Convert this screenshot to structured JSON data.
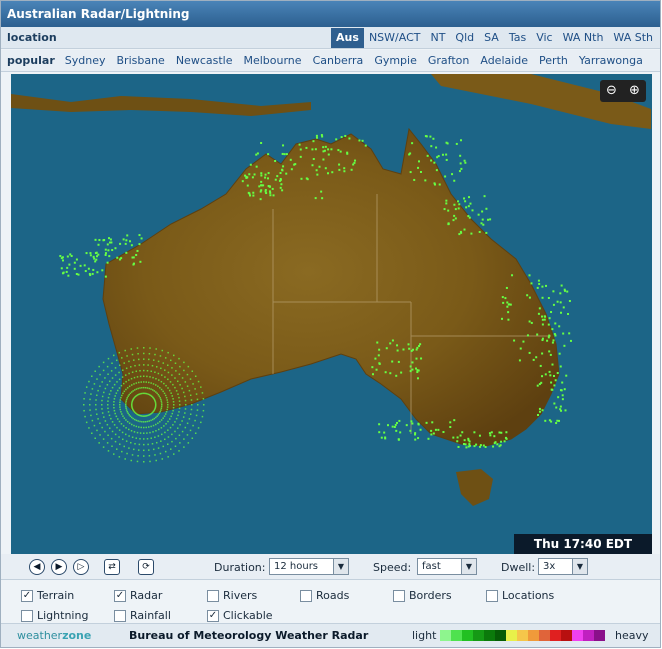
{
  "title": "Australian Radar/Lightning",
  "location": {
    "label": "location",
    "regions": [
      "Aus",
      "NSW/ACT",
      "NT",
      "Qld",
      "SA",
      "Tas",
      "Vic",
      "WA Nth",
      "WA Sth"
    ],
    "active_region": "Aus"
  },
  "popular": {
    "label": "popular",
    "cities": [
      "Sydney",
      "Brisbane",
      "Newcastle",
      "Melbourne",
      "Canberra",
      "Gympie",
      "Grafton",
      "Adelaide",
      "Perth",
      "Yarrawonga"
    ]
  },
  "map": {
    "timestamp": "Thu 17:40 EDT",
    "zoom_out_icon": "zoom-out-icon",
    "zoom_in_icon": "zoom-in-icon",
    "colors": {
      "ocean": "#1c6587",
      "land": "#7a5a1a",
      "radar_echo": "#66ff44"
    }
  },
  "controls": {
    "duration_label": "Duration:",
    "duration_value": "12 hours",
    "speed_label": "Speed:",
    "speed_value": "fast",
    "dwell_label": "Dwell:",
    "dwell_value": "3x"
  },
  "layers": [
    {
      "label": "Terrain",
      "checked": true
    },
    {
      "label": "Radar",
      "checked": true
    },
    {
      "label": "Rivers",
      "checked": false
    },
    {
      "label": "Roads",
      "checked": false
    },
    {
      "label": "Borders",
      "checked": false
    },
    {
      "label": "Locations",
      "checked": false
    },
    {
      "label": "Lightning",
      "checked": false
    },
    {
      "label": "Rainfall",
      "checked": false
    },
    {
      "label": "Clickable",
      "checked": true
    }
  ],
  "footer": {
    "brand_prefix": "weather",
    "brand_suffix": "zone",
    "title": "Bureau of Meteorology Weather Radar",
    "legend_light": "light",
    "legend_heavy": "heavy",
    "legend_colors": [
      "#8ef58e",
      "#4fe24f",
      "#22c022",
      "#159a15",
      "#0b7a0b",
      "#065c06",
      "#e8f04a",
      "#f5c64a",
      "#f09a3a",
      "#e0643a",
      "#e02020",
      "#b81010",
      "#f040f0",
      "#c020c0",
      "#8a108a"
    ]
  }
}
